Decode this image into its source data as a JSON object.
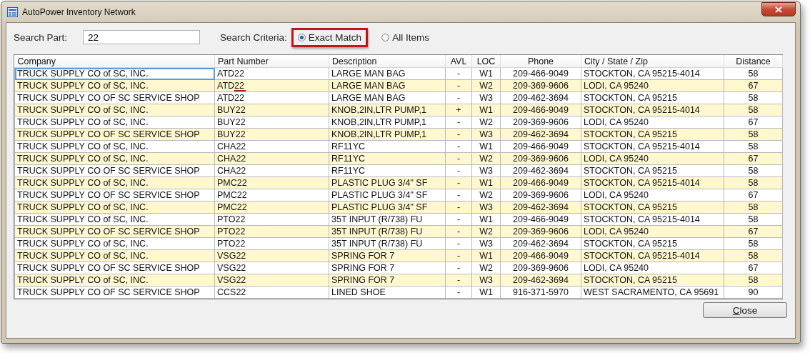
{
  "window": {
    "title": "AutoPower Inventory Network"
  },
  "search": {
    "label": "Search Part:",
    "value": "22"
  },
  "criteria": {
    "label": "Search Criteria:",
    "options": [
      {
        "label": "Exact Match",
        "selected": true,
        "highlighted": true
      },
      {
        "label": "All Items",
        "selected": false,
        "highlighted": false
      }
    ]
  },
  "table": {
    "columns": [
      "Company",
      "Part Number",
      "Description",
      "AVL",
      "LOC",
      "Phone",
      "City / State / Zip",
      "Distance"
    ],
    "rows": [
      {
        "cells": [
          "TRUCK SUPPLY CO of SC, INC.",
          "ATD22",
          "LARGE MAN BAG",
          "-",
          "W1",
          "209-466-9049",
          "STOCKTON, CA 95215-4014",
          "58"
        ],
        "focused": true,
        "marked": false
      },
      {
        "cells": [
          "TRUCK SUPPLY CO of SC, INC.",
          "ATD22",
          "LARGE MAN BAG",
          "-",
          "W2",
          "209-369-9606",
          "LODI, CA 95240",
          "67"
        ],
        "focused": false,
        "marked": true
      },
      {
        "cells": [
          "TRUCK SUPPLY CO OF SC SERVICE SHOP",
          "ATD22",
          "LARGE MAN BAG",
          "-",
          "W3",
          "209-462-3694",
          "STOCKTON, CA 95215",
          "58"
        ],
        "focused": false,
        "marked": false
      },
      {
        "cells": [
          "TRUCK SUPPLY CO of SC, INC.",
          "BUY22",
          "KNOB,2IN,LTR PUMP,1",
          "+",
          "W1",
          "209-466-9049",
          "STOCKTON, CA 95215-4014",
          "58"
        ],
        "focused": false,
        "marked": false
      },
      {
        "cells": [
          "TRUCK SUPPLY CO of SC, INC.",
          "BUY22",
          "KNOB,2IN,LTR PUMP,1",
          "-",
          "W2",
          "209-369-9606",
          "LODI, CA 95240",
          "67"
        ],
        "focused": false,
        "marked": false
      },
      {
        "cells": [
          "TRUCK SUPPLY CO OF SC SERVICE SHOP",
          "BUY22",
          "KNOB,2IN,LTR PUMP,1",
          "-",
          "W3",
          "209-462-3694",
          "STOCKTON, CA 95215",
          "58"
        ],
        "focused": false,
        "marked": false
      },
      {
        "cells": [
          "TRUCK SUPPLY CO of SC, INC.",
          "CHA22",
          "RF11YC",
          "-",
          "W1",
          "209-466-9049",
          "STOCKTON, CA 95215-4014",
          "58"
        ],
        "focused": false,
        "marked": false
      },
      {
        "cells": [
          "TRUCK SUPPLY CO of SC, INC.",
          "CHA22",
          "RF11YC",
          "-",
          "W2",
          "209-369-9606",
          "LODI, CA 95240",
          "67"
        ],
        "focused": false,
        "marked": false
      },
      {
        "cells": [
          "TRUCK SUPPLY CO OF SC SERVICE SHOP",
          "CHA22",
          "RF11YC",
          "-",
          "W3",
          "209-462-3694",
          "STOCKTON, CA 95215",
          "58"
        ],
        "focused": false,
        "marked": false
      },
      {
        "cells": [
          "TRUCK SUPPLY CO of SC, INC.",
          "PMC22",
          "PLASTIC PLUG 3/4\" SF",
          "-",
          "W1",
          "209-466-9049",
          "STOCKTON, CA 95215-4014",
          "58"
        ],
        "focused": false,
        "marked": false
      },
      {
        "cells": [
          "TRUCK SUPPLY CO OF SC SERVICE SHOP",
          "PMC22",
          "PLASTIC PLUG 3/4\" SF",
          "-",
          "W2",
          "209-369-9606",
          "LODI, CA 95240",
          "67"
        ],
        "focused": false,
        "marked": false
      },
      {
        "cells": [
          "TRUCK SUPPLY CO of SC, INC.",
          "PMC22",
          "PLASTIC PLUG 3/4\" SF",
          "-",
          "W3",
          "209-462-3694",
          "STOCKTON, CA 95215",
          "58"
        ],
        "focused": false,
        "marked": false
      },
      {
        "cells": [
          "TRUCK SUPPLY CO of SC, INC.",
          "PTO22",
          "35T INPUT (R/738) FU",
          "-",
          "W1",
          "209-466-9049",
          "STOCKTON, CA 95215-4014",
          "58"
        ],
        "focused": false,
        "marked": false
      },
      {
        "cells": [
          "TRUCK SUPPLY CO OF SC SERVICE SHOP",
          "PTO22",
          "35T INPUT (R/738) FU",
          "-",
          "W2",
          "209-369-9606",
          "LODI, CA 95240",
          "67"
        ],
        "focused": false,
        "marked": false
      },
      {
        "cells": [
          "TRUCK SUPPLY CO of SC, INC.",
          "PTO22",
          "35T INPUT (R/738) FU",
          "-",
          "W3",
          "209-462-3694",
          "STOCKTON, CA 95215",
          "58"
        ],
        "focused": false,
        "marked": false
      },
      {
        "cells": [
          "TRUCK SUPPLY CO of SC, INC.",
          "VSG22",
          "SPRING FOR 7",
          "-",
          "W1",
          "209-466-9049",
          "STOCKTON, CA 95215-4014",
          "58"
        ],
        "focused": false,
        "marked": false
      },
      {
        "cells": [
          "TRUCK SUPPLY CO OF SC SERVICE SHOP",
          "VSG22",
          "SPRING FOR 7",
          "-",
          "W2",
          "209-369-9606",
          "LODI, CA 95240",
          "67"
        ],
        "focused": false,
        "marked": false
      },
      {
        "cells": [
          "TRUCK SUPPLY CO of SC, INC.",
          "VSG22",
          "SPRING FOR 7",
          "-",
          "W3",
          "209-462-3694",
          "STOCKTON, CA 95215",
          "58"
        ],
        "focused": false,
        "marked": false
      },
      {
        "cells": [
          "TRUCK SUPPLY CO OF SC SERVICE SHOP",
          "CCS22",
          "LINED SHOE",
          "-",
          "W1",
          "916-371-5970",
          "WEST SACRAMENTO, CA 95691",
          "90"
        ],
        "focused": false,
        "marked": false
      }
    ]
  },
  "buttons": [
    "Close"
  ]
}
